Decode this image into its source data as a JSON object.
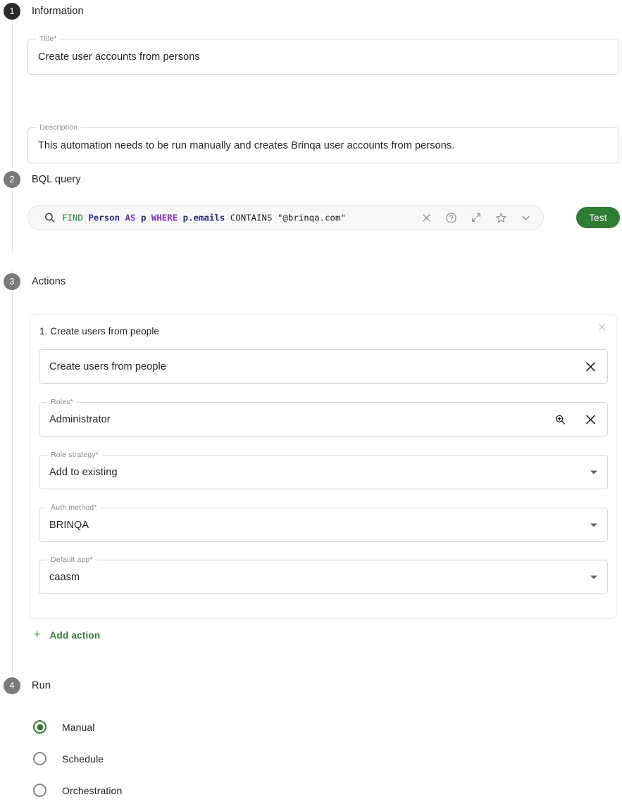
{
  "steps": [
    {
      "number": "1",
      "title": "Information"
    },
    {
      "number": "2",
      "title": "BQL query"
    },
    {
      "number": "3",
      "title": "Actions"
    },
    {
      "number": "4",
      "title": "Run"
    }
  ],
  "information": {
    "title_field": {
      "label": "Title*",
      "value": "Create user accounts from persons",
      "placeholder": "Title"
    },
    "description_field": {
      "label": "Description",
      "value": "This automation needs to be run manually and creates Brinqa user accounts from persons.",
      "placeholder": "Description"
    }
  },
  "bql": {
    "placeholder": "Search",
    "query_tokens": [
      {
        "text": "FIND",
        "kind": "kw"
      },
      {
        "text": " ",
        "kind": "txt"
      },
      {
        "text": "Person",
        "kind": "ent"
      },
      {
        "text": " ",
        "kind": "txt"
      },
      {
        "text": "AS",
        "kind": "op"
      },
      {
        "text": " ",
        "kind": "txt"
      },
      {
        "text": "p",
        "kind": "ent"
      },
      {
        "text": " ",
        "kind": "txt"
      },
      {
        "text": "WHERE",
        "kind": "op"
      },
      {
        "text": " ",
        "kind": "txt"
      },
      {
        "text": "p.emails",
        "kind": "attr"
      },
      {
        "text": " CONTAINS \"@brinqa.com\"",
        "kind": "txt"
      }
    ],
    "query_text": "FIND Person AS p WHERE p.emails CONTAINS \"@brinqa.com\"",
    "icons": [
      "clear-icon",
      "help-icon",
      "expand-icon",
      "favorite-icon",
      "chevron-down-icon"
    ],
    "test_label": "Test",
    "test_color": "#2e7d32"
  },
  "actions": {
    "card_title": "1. Create users from people",
    "name_field": {
      "label": "",
      "value": "Create users from people",
      "placeholder": "Action"
    },
    "fields": [
      {
        "label": "Roles*",
        "value": "Administrator",
        "type": "lookup"
      },
      {
        "label": "Role strategy*",
        "value": "Add to existing",
        "type": "select"
      },
      {
        "label": "Auth method*",
        "value": "BRINQA",
        "type": "select"
      },
      {
        "label": "Default app*",
        "value": "caasm",
        "type": "select"
      }
    ],
    "add_action_label": "Add action",
    "add_action_color": "#2e7d32"
  },
  "run": {
    "options": [
      {
        "label": "Manual",
        "selected": true
      },
      {
        "label": "Schedule",
        "selected": false
      },
      {
        "label": "Orchestration",
        "selected": false
      }
    ],
    "accent_color": "#2e7d32"
  }
}
